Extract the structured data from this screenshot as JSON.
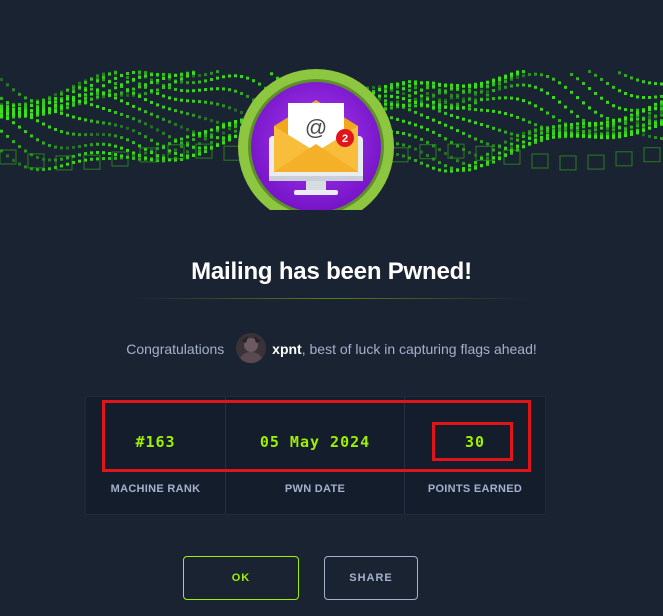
{
  "title": "Mailing has been Pwned!",
  "congrats": {
    "prefix": "Congratulations",
    "username": "xpnt",
    "suffix": ", best of luck in capturing flags ahead!"
  },
  "stats": [
    {
      "value": "#163",
      "label": "MACHINE RANK"
    },
    {
      "value": "05 May 2024",
      "label": "PWN DATE"
    },
    {
      "value": "30",
      "label": "POINTS EARNED"
    }
  ],
  "buttons": {
    "ok_label": "OK",
    "share_label": "SHARE"
  },
  "badge": {
    "icon_symbol": "@",
    "notification_count": "2"
  },
  "colors": {
    "background": "#1a2332",
    "accent_green": "#9fef00",
    "badge_ring": "#8dc63f",
    "badge_fill": "#8a17d8",
    "highlight_red": "#e0151b"
  }
}
